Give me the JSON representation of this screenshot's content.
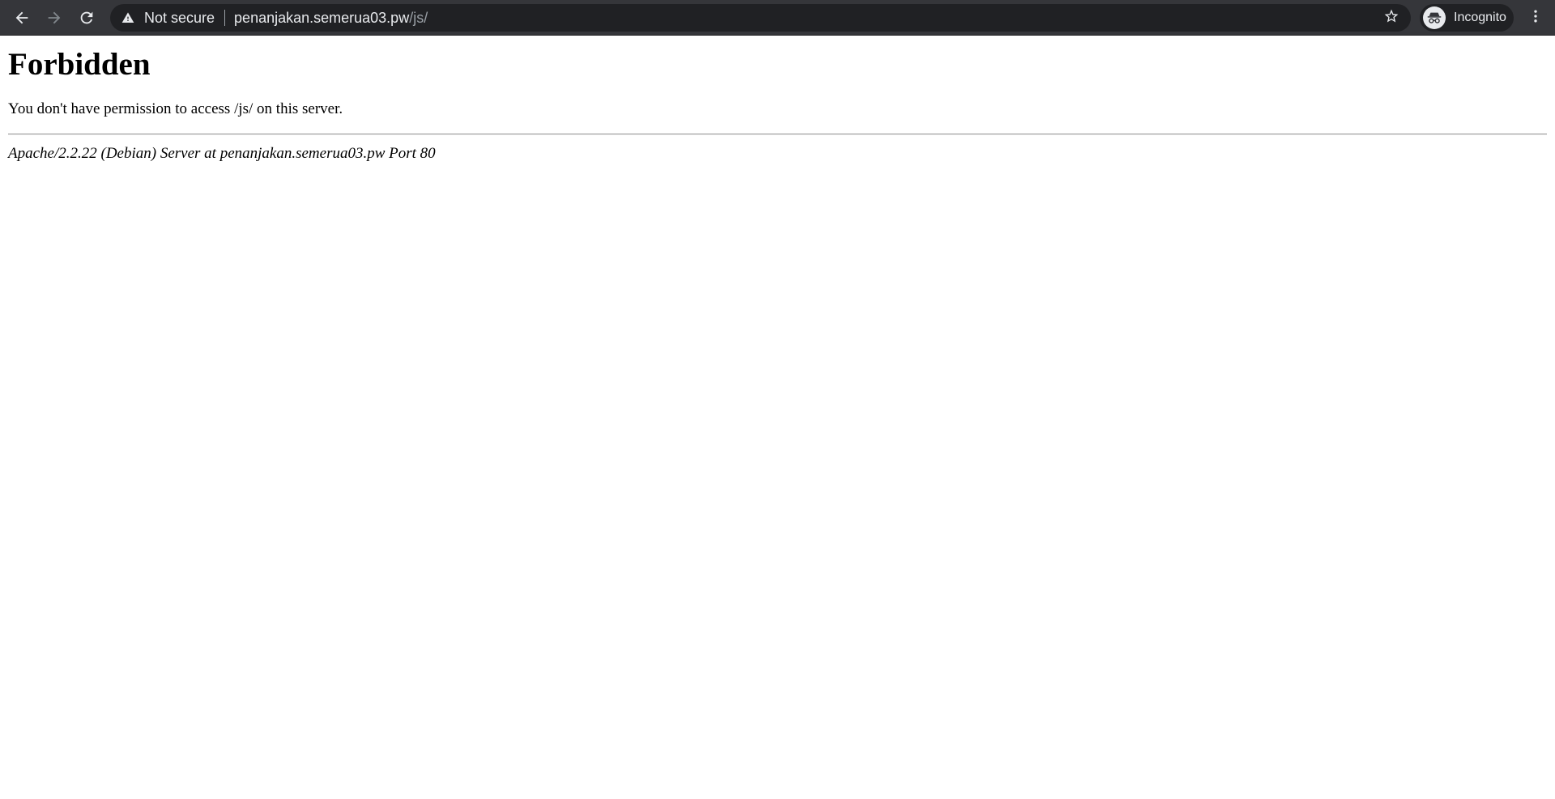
{
  "browser": {
    "security_label": "Not secure",
    "url_host": "penanjakan.semerua03.pw",
    "url_path": "/js/",
    "profile_label": "Incognito",
    "icons": {
      "back": "arrow-left-icon",
      "forward": "arrow-right-icon",
      "reload": "reload-icon",
      "security": "warning-triangle-icon",
      "bookmark": "star-icon",
      "profile": "incognito-icon",
      "menu": "kebab-menu-icon"
    },
    "colors": {
      "toolbar_bg": "#35363a",
      "omnibox_bg": "#202124",
      "text": "#e8eaed",
      "muted_text": "#9aa0a6"
    }
  },
  "page": {
    "title": "Forbidden",
    "message": "You don't have permission to access /js/ on this server.",
    "server_signature": "Apache/2.2.22 (Debian) Server at penanjakan.semerua03.pw Port 80"
  }
}
